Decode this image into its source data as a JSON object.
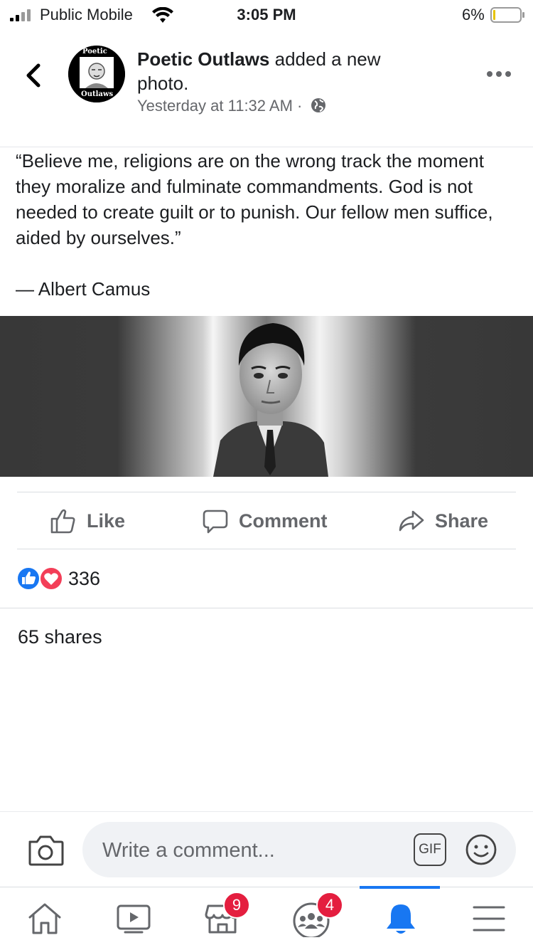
{
  "status_bar": {
    "carrier": "Public Mobile",
    "time": "3:05 PM",
    "battery": "6%"
  },
  "post": {
    "page_name": "Poetic Outlaws",
    "action": "added a new photo.",
    "timestamp": "Yesterday at 11:32 AM ·",
    "quote": "“Believe me, religions are on the wrong track the moment they moralize and fulminate commandments. God is not needed to create guilt or to punish. Our fellow men suffice, aided by ourselves.”",
    "author": "— Albert Camus",
    "avatar_text_top": "Poetic",
    "avatar_text_bottom": "Outlaws"
  },
  "actions": {
    "like": "Like",
    "comment": "Comment",
    "share": "Share"
  },
  "reactions": {
    "count": "336",
    "shares": "65 shares"
  },
  "composer": {
    "placeholder": "Write a comment...",
    "gif_label": "GIF"
  },
  "tabbar": {
    "marketplace_badge": "9",
    "groups_badge": "4"
  },
  "colors": {
    "accent": "#1877f2",
    "badge": "#e41e3f",
    "muted": "#65676b"
  }
}
